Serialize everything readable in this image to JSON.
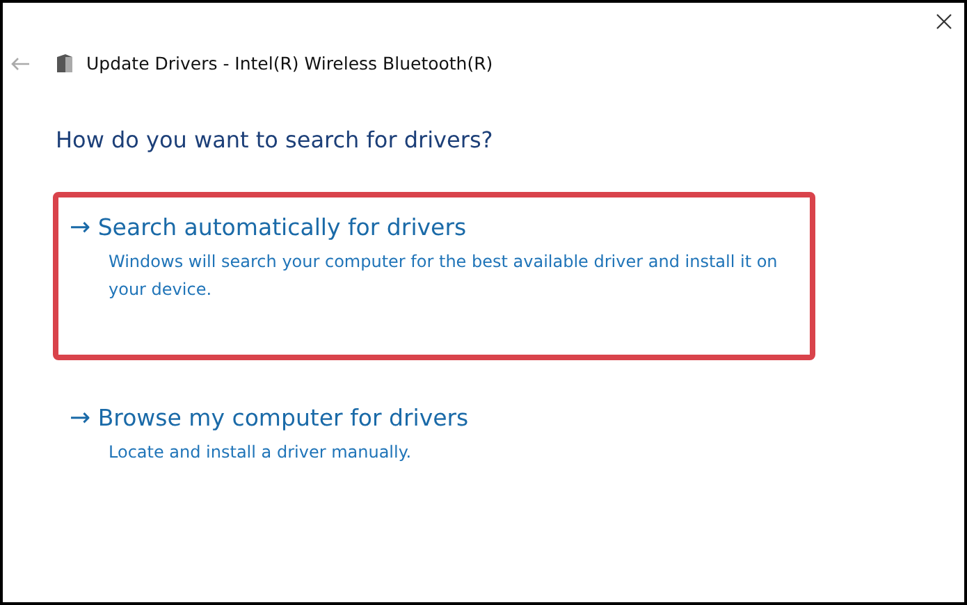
{
  "window": {
    "title": "Update Drivers - Intel(R) Wireless Bluetooth(R)"
  },
  "heading": "How do you want to search for drivers?",
  "options": [
    {
      "arrow": "→",
      "title": "Search automatically for drivers",
      "description": "Windows will search your computer for the best available driver and install it on your device.",
      "highlighted": true
    },
    {
      "arrow": "→",
      "title": "Browse my computer for drivers",
      "description": "Locate and install a driver manually.",
      "highlighted": false
    }
  ]
}
